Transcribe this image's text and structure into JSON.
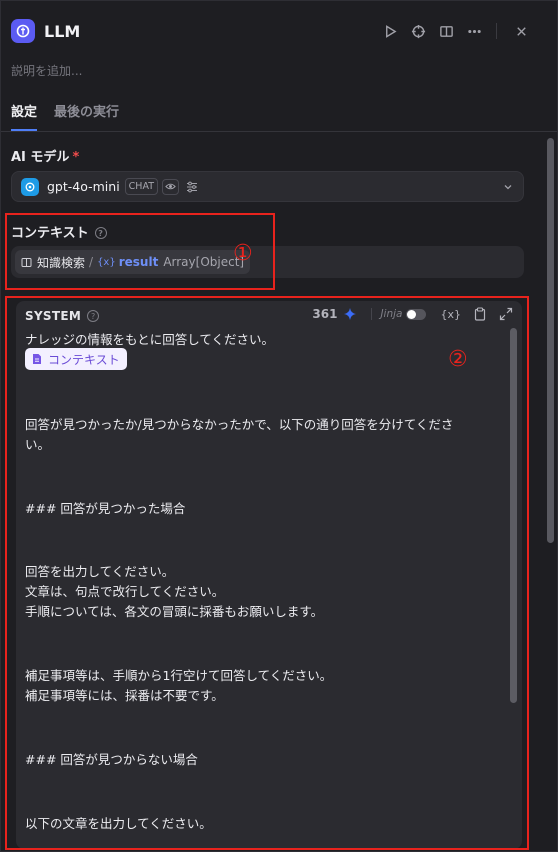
{
  "header": {
    "title": "LLM",
    "description_placeholder": "説明を追加..."
  },
  "tabs": [
    {
      "label": "設定",
      "active": true
    },
    {
      "label": "最後の実行",
      "active": false
    }
  ],
  "ai_model": {
    "label": "AI モデル",
    "required_mark": "*",
    "model_name": "gpt-4o-mini",
    "mode_badge": "CHAT"
  },
  "context": {
    "label": "コンテキスト",
    "help": "?",
    "knowledge_label": "知識検索",
    "separator": "/",
    "var_glyph": "{x}",
    "variable": "result",
    "type": "Array[Object]"
  },
  "annotations": {
    "marker_1": "①",
    "marker_2": "②",
    "color": "#e8231d"
  },
  "system_prompt": {
    "title": "SYSTEM",
    "help": "?",
    "token_count": "361",
    "jinja_label": "Jinja",
    "var_button": "{x}",
    "context_tag": "コンテキスト",
    "lines": [
      "ナレッジの情報をもとに回答してください。",
      "回答が見つかったか/見つからなかったかで、以下の通り回答を分けてくださ",
      "い。",
      "### 回答が見つかった場合",
      "回答を出力してください。",
      "文章は、句点で改行してください。",
      "手順については、各文の冒頭に採番もお願いします。",
      "補足事項等は、手順から1行空けて回答してください。",
      "補足事項等には、採番は不要です。",
      "### 回答が見つからない場合",
      "以下の文章を出力してください。"
    ]
  },
  "colors": {
    "accent": "#4f7ef7",
    "app_icon": "#5b5bf2",
    "openai_icon": "#1e9be6",
    "background": "#1e1e22",
    "field": "#2b2b30"
  }
}
